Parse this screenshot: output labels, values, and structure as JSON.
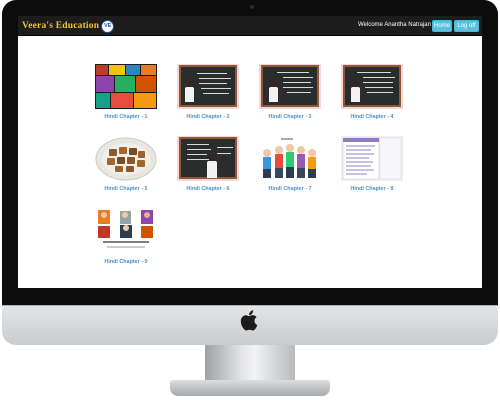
{
  "header": {
    "brand": "Veera's Education",
    "logo_text": "VE",
    "welcome": "Welcome Anantha Natrajan",
    "home_label": "Home",
    "logoff_label": "Log off"
  },
  "chapters": [
    {
      "label": "Hindi Chapter - 1"
    },
    {
      "label": "Hindi Chapter - 2"
    },
    {
      "label": "Hindi Chapter - 3"
    },
    {
      "label": "Hindi Chapter - 4"
    },
    {
      "label": "Hindi Chapter - 5"
    },
    {
      "label": "Hindi Chapter - 6"
    },
    {
      "label": "Hindi Chapter - 7"
    },
    {
      "label": "Hindi Chapter - 8"
    },
    {
      "label": "Hindi Chapter - 9"
    }
  ],
  "colors": {
    "brand": "#f2c230",
    "navbar": "#1d1d1d",
    "button": "#5bc0de",
    "chapter_link": "#4a90c9"
  }
}
